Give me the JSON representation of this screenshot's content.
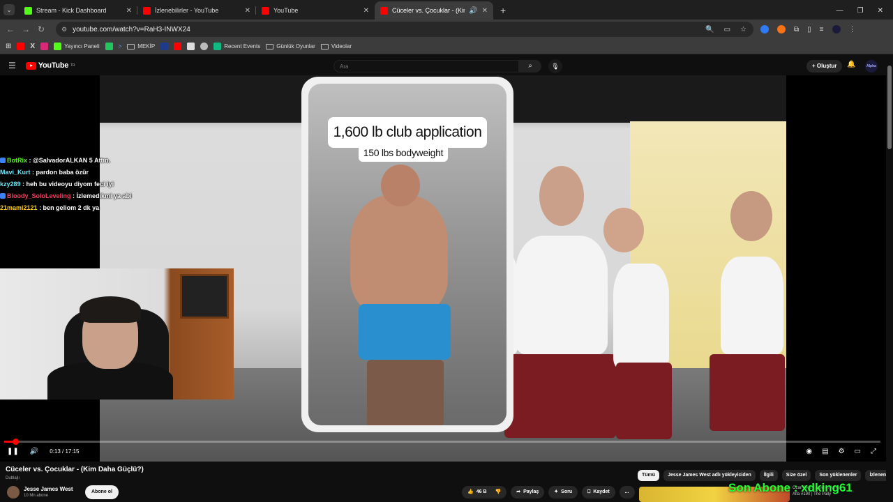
{
  "browser": {
    "tabs": [
      {
        "title": "Stream - Kick Dashboard",
        "icon": "kick-icon",
        "color": "#53fc18"
      },
      {
        "title": "İzlenebilirler - YouTube",
        "icon": "youtube-icon",
        "color": "#ff0000"
      },
      {
        "title": "YouTube",
        "icon": "youtube-icon",
        "color": "#ff0000"
      },
      {
        "title": "Cüceler vs. Çocuklar - (Kim",
        "icon": "youtube-icon",
        "color": "#ff0000",
        "active": true
      }
    ],
    "url": "youtube.com/watch?v=RaH3-INWX24",
    "bookmarks": [
      {
        "label": "",
        "icon": "youtube-icon"
      },
      {
        "label": "",
        "icon": "x-icon"
      },
      {
        "label": "",
        "icon": "instagram-icon"
      },
      {
        "label": "Yayıncı Paneli",
        "icon": "kick-icon"
      },
      {
        "label": "",
        "icon": "app-icon"
      },
      {
        "label": "",
        "icon": "prime-icon"
      },
      {
        "label": "MEKİP",
        "icon": "folder-icon"
      },
      {
        "label": "",
        "icon": "app-icon"
      },
      {
        "label": "",
        "icon": "youtube-icon"
      },
      {
        "label": "",
        "icon": "image-icon"
      },
      {
        "label": "",
        "icon": "app-icon"
      },
      {
        "label": "Recent Events",
        "icon": "streamelements-icon"
      },
      {
        "label": "Günlük Oyunlar",
        "icon": "folder-icon"
      },
      {
        "label": "Videolar",
        "icon": "folder-icon"
      }
    ]
  },
  "youtube": {
    "logo": "YouTube",
    "logo_region": "TR",
    "search_placeholder": "Ara",
    "create_label": "Oluştur",
    "avatar_text": "Alpha"
  },
  "video_overlay": {
    "card_title": "1,600 lb club application",
    "card_subtitle": "150 lbs bodyweight"
  },
  "chat": [
    {
      "user": "BotRix",
      "color": "#53fc18",
      "message": ": @SalvadorALKAN 5 Attın."
    },
    {
      "user": "Mavi_Kurt",
      "color": "#6ee7f9",
      "message": ": pardon baba özür"
    },
    {
      "user": "kzy289",
      "color": "#67e8f9",
      "message": ": heh bu videoyu diyom feci iyi"
    },
    {
      "user": "Bloody_SoloLeveling",
      "color": "#f43f5e",
      "message": ": İzlemedikmi ya abi"
    },
    {
      "user": "21mami2121",
      "color": "#facc15",
      "message": ": ben geliom 2 dk ya"
    }
  ],
  "player": {
    "time": "0:13 / 17:15",
    "progress_fraction": 0.0126
  },
  "video": {
    "title": "Cüceler vs. Çocuklar - (Kim Daha Güçlü?)",
    "dubbed": "Dublajlı",
    "channel": "Jesse James West",
    "subscribers": "10 Mn abone",
    "subscribe_label": "Abone ol",
    "likes": "46 B",
    "share_label": "Paylaş",
    "ask_label": "Soru",
    "save_label": "Kaydet",
    "more_label": "..."
  },
  "chips": [
    "Tümü",
    "Jesse James West adlı yükleyiciden",
    "İlgili",
    "Size özel",
    "Son yüklenenler",
    "İzlenenler"
  ],
  "next_video": {
    "title": "Ozan Akar | Alfa'nın Amca",
    "subtitle": "Alfa #190 | The Pally"
  },
  "stream_overlay": "Son Abone : xdking61"
}
